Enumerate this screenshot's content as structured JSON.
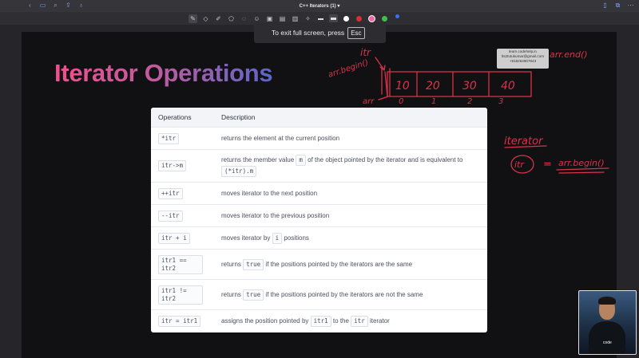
{
  "app": {
    "title": "C++ Iterators",
    "page_indicator": "(1)",
    "title_chevron": "▾"
  },
  "topbar": {
    "left_icons": [
      "back-icon",
      "sidebar-icon",
      "search-icon",
      "share-icon",
      "mic-icon"
    ],
    "right_icons": [
      "bookmark-icon",
      "copy-icon",
      "more-icon"
    ]
  },
  "toolbar": {
    "tools": [
      "pen-icon",
      "eraser-icon",
      "highlighter-icon",
      "shapes-icon",
      "lasso-icon",
      "text-icon",
      "image-icon",
      "sticker-icon",
      "book-icon",
      "pointer-icon"
    ],
    "colors": [
      "#ffffff",
      "#d63030",
      "#e96aa6",
      "#3fbf4a",
      "#3a6ff0"
    ]
  },
  "toast": {
    "message": "To exit full screen, press",
    "key": "Esc"
  },
  "slide": {
    "title": "Iterator Operations",
    "table": {
      "headers": [
        "Operations",
        "Description"
      ],
      "rows": [
        {
          "op": "*itr",
          "desc": [
            "returns the element at the current position"
          ]
        },
        {
          "op": "itr->m",
          "desc": [
            "returns the member value ",
            "m",
            " of the object  pointed by the iterator and is equivalent to ",
            "(*itr).m"
          ]
        },
        {
          "op": "++itr",
          "desc": [
            "moves iterator to the next position"
          ]
        },
        {
          "op": "--itr",
          "desc": [
            "moves iterator to the previous position"
          ]
        },
        {
          "op": "itr + i",
          "desc": [
            "moves iterator by ",
            "i",
            " positions"
          ]
        },
        {
          "op": "itr1 ==\nitr2",
          "desc": [
            "returns ",
            "true",
            " if the positions pointed by the iterators are the same"
          ]
        },
        {
          "op": "itr1 !=\nitr2",
          "desc": [
            "returns ",
            "true",
            " if the positions pointed by the iterators are not the same"
          ]
        },
        {
          "op": "itr = itr1",
          "desc": [
            "assigns the position pointed by ",
            "itr1",
            " to the ",
            "itr",
            " iterator"
          ]
        }
      ]
    }
  },
  "annotations": {
    "array_values": [
      "10",
      "20",
      "30",
      "40"
    ],
    "array_indices": [
      "0",
      "1",
      "2",
      "3"
    ],
    "label_itr": "itr",
    "label_begin": "arr.begin()",
    "label_end": "arr.end()",
    "label_arr": "arr",
    "label_iterator": "iterator",
    "label_itr_circle": "itr",
    "label_equals": "=",
    "label_begin2": "arr.begin()",
    "ink_color": "#d8334a"
  },
  "watermark": {
    "line1": "learn.codehelp.in",
    "line2": "lts2tutukumar@gmail.com",
    "line3": "+918264907643"
  },
  "webcam": {
    "logo": "code"
  }
}
